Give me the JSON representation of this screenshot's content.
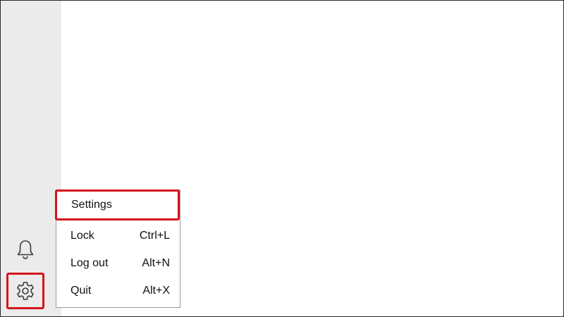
{
  "sidebar": {
    "buttons": [
      {
        "icon": "bell-icon"
      },
      {
        "icon": "gear-icon"
      }
    ]
  },
  "menu": {
    "items": [
      {
        "label": "Settings",
        "shortcut": ""
      },
      {
        "label": "Lock",
        "shortcut": "Ctrl+L"
      },
      {
        "label": "Log out",
        "shortcut": "Alt+N"
      },
      {
        "label": "Quit",
        "shortcut": "Alt+X"
      }
    ]
  },
  "colors": {
    "highlight": "#d4141c",
    "sidebar_bg": "#ebebeb",
    "menu_border": "#9a9a9a"
  }
}
